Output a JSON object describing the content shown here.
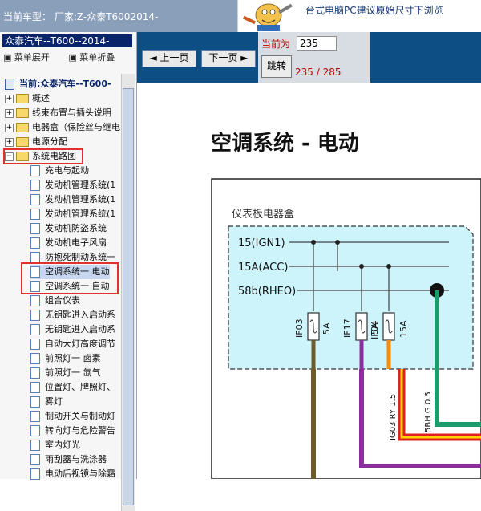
{
  "header": {
    "current_vehicle": "当前车型：  厂家:Z-众泰T6002014-",
    "banner_text": "台式电脑PC建议原始尺寸下浏览"
  },
  "sidebar": {
    "title": "众泰汽车--T600--2014-",
    "expand_label": "菜单展开",
    "collapse_label": "菜单折叠",
    "current_label": "当前:众泰汽车--T600-",
    "items": [
      {
        "label": "概述"
      },
      {
        "label": "线束布置与插头说明"
      },
      {
        "label": "电器盒（保险丝与继电"
      },
      {
        "label": "电源分配"
      },
      {
        "label": "系统电路图"
      }
    ],
    "children": [
      {
        "label": "充电与起动"
      },
      {
        "label": "发动机管理系统(1"
      },
      {
        "label": "发动机管理系统(1"
      },
      {
        "label": "发动机管理系统(1"
      },
      {
        "label": "发动机防盗系统"
      },
      {
        "label": "发动机电子风扇"
      },
      {
        "label": "防抱死制动系统一"
      },
      {
        "label": "空调系统一 电动"
      },
      {
        "label": "空调系统一 自动"
      },
      {
        "label": "组合仪表"
      },
      {
        "label": "无钥匙进入启动系"
      },
      {
        "label": "无钥匙进入启动系"
      },
      {
        "label": "自动大灯高度调节"
      },
      {
        "label": "前照灯一 卤素"
      },
      {
        "label": "前照灯一 氙气"
      },
      {
        "label": "位置灯、牌照灯、"
      },
      {
        "label": "雾灯"
      },
      {
        "label": "制动开关与制动灯"
      },
      {
        "label": "转向灯与危险警告"
      },
      {
        "label": "室内灯光"
      },
      {
        "label": "雨刮器与洗涤器"
      },
      {
        "label": "电动后视镜与除霜"
      }
    ]
  },
  "nav": {
    "prev_label": "上一页",
    "next_label": "下一页",
    "current_label": "当前为",
    "page_value": "235",
    "jump_label": "跳转",
    "page_count": "235 / 285"
  },
  "page": {
    "title": "空调系统 - 电动",
    "box_label": "仪表板电器盒",
    "bus1": "15(IGN1)",
    "bus2": "15A(ACC)",
    "bus3": "58b(RHEO)",
    "fuse1_id": "IF03",
    "fuse1_rating": "5A",
    "fuse2_id": "IF17",
    "fuse2_rating": "5A",
    "fuse3_id": "IF04",
    "fuse3_rating": "15A",
    "wire1_label": "IG03  RY  1.5",
    "wire2_label": "5BH  G  0.5"
  },
  "colors": {
    "nav_blue": "#0d4e84",
    "highlight_red": "#e2302f",
    "box_fill": "#cdf3fb",
    "wire_green": "#1c9c6a",
    "wire_purple": "#8a2f9c",
    "wire_orange": "#ff8a00",
    "wire_olive": "#6d5c2a"
  }
}
